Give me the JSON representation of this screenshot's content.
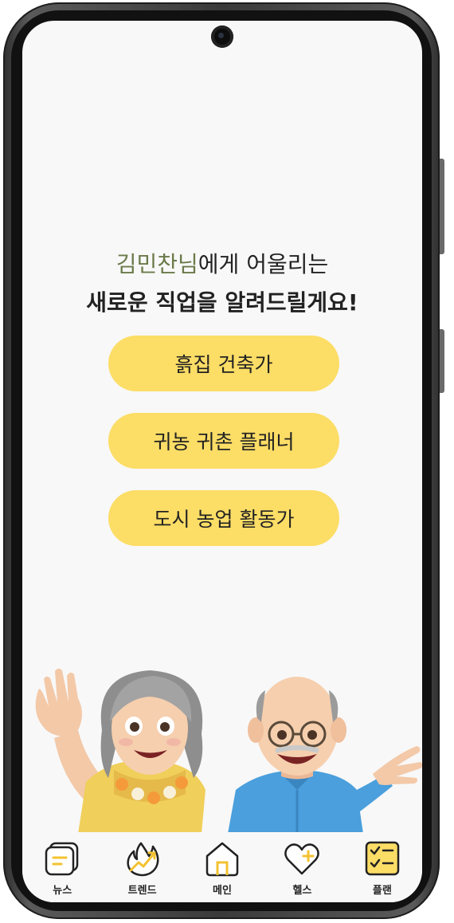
{
  "headline": {
    "name": "김민찬님",
    "line1_rest": "에게 어울리는",
    "line2_bold": "새로운 직업",
    "line2_rest": "을 알려드릴게요!"
  },
  "jobs": [
    {
      "label": "흙집 건축가"
    },
    {
      "label": "귀농 귀촌 플래너"
    },
    {
      "label": "도시 농업 활동가"
    }
  ],
  "nav": [
    {
      "label": "뉴스",
      "icon": "news-icon"
    },
    {
      "label": "트렌드",
      "icon": "trend-icon"
    },
    {
      "label": "메인",
      "icon": "home-icon"
    },
    {
      "label": "헬스",
      "icon": "heart-plus-icon"
    },
    {
      "label": "플랜",
      "icon": "plan-checklist-icon",
      "active": true
    }
  ],
  "colors": {
    "accent": "#fcdd66",
    "name": "#6b7a4a",
    "background": "#f8f8f8"
  }
}
